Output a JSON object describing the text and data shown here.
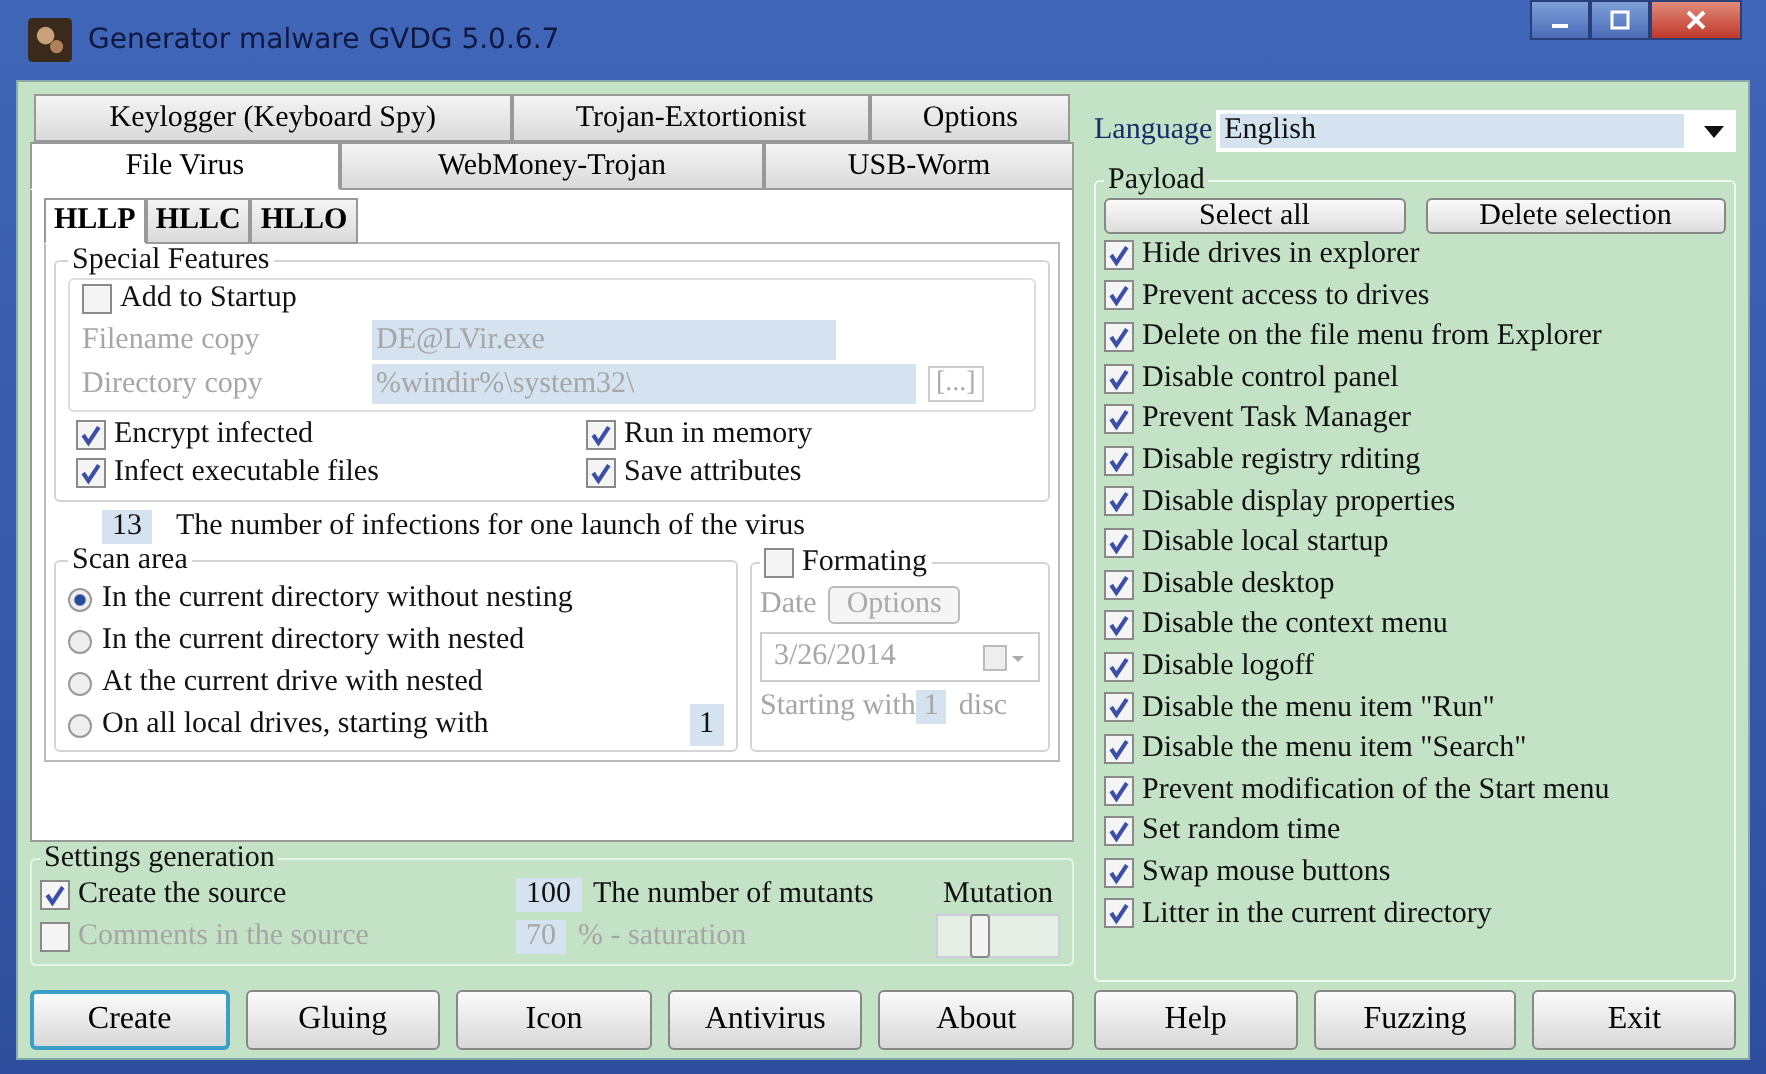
{
  "window": {
    "title": "Generator malware GVDG 5.0.6.7"
  },
  "main_tab_rows": [
    [
      {
        "label": "Keylogger (Keyboard Spy)",
        "selected": false
      },
      {
        "label": "Trojan-Extortionist",
        "selected": false
      },
      {
        "label": "Options",
        "selected": false
      }
    ],
    [
      {
        "label": "File Virus",
        "selected": true
      },
      {
        "label": "WebMoney-Trojan",
        "selected": false
      },
      {
        "label": "USB-Worm",
        "selected": false
      }
    ]
  ],
  "sub_tabs": [
    {
      "label": "HLLP",
      "selected": true
    },
    {
      "label": "HLLC",
      "selected": false
    },
    {
      "label": "HLLO",
      "selected": false
    }
  ],
  "special_features": {
    "title": "Special Features",
    "add_to_startup": {
      "label": "Add to Startup",
      "checked": false
    },
    "fields": [
      {
        "label": "Filename copy",
        "value": "DE@LVir.exe",
        "disabled": true
      },
      {
        "label": "Directory copy",
        "value": "%windir%\\system32\\",
        "disabled": true,
        "browse": "[...]"
      }
    ],
    "options": [
      {
        "label": "Encrypt infected",
        "checked": true
      },
      {
        "label": "Run in memory",
        "checked": true
      },
      {
        "label": "Infect executable files",
        "checked": true
      },
      {
        "label": "Save attributes",
        "checked": true
      }
    ]
  },
  "infections": {
    "value": "13",
    "label": "The number of infections for one launch of the virus"
  },
  "scan_area": {
    "title": "Scan area",
    "options": [
      {
        "label": "In the current directory without nesting",
        "selected": true
      },
      {
        "label": "In the current directory with nested",
        "selected": false
      },
      {
        "label": "At the current drive with nested",
        "selected": false
      },
      {
        "label": "On all local drives, starting with",
        "selected": false
      }
    ],
    "drive_value": "1"
  },
  "formatting": {
    "label": "Formating",
    "checked": false,
    "date_label": "Date",
    "options_button": "Options",
    "date": "3/26/2014",
    "starting_label": "Starting with",
    "disc_value": "1",
    "disc_label": "disc"
  },
  "settings_generation": {
    "title": "Settings generation",
    "create_source": {
      "label": "Create the source",
      "checked": true
    },
    "comments": {
      "label": "Comments in the source",
      "checked": false,
      "disabled": true
    },
    "mutants": {
      "value": "100",
      "label": "The number of mutants"
    },
    "saturation": {
      "value": "70",
      "label": "% - saturation",
      "disabled": true
    },
    "mutation": {
      "label": "Mutation",
      "level": 0.35
    }
  },
  "language": {
    "label": "Language",
    "value": "English"
  },
  "payload": {
    "title": "Payload",
    "buttons": [
      "Select all",
      "Delete selection"
    ],
    "items": [
      {
        "label": "Hide drives in explorer",
        "checked": true
      },
      {
        "label": "Prevent access to drives",
        "checked": true
      },
      {
        "label": "Delete on the file menu from Explorer",
        "checked": true
      },
      {
        "label": "Disable control panel",
        "checked": true
      },
      {
        "label": "Prevent Task Manager",
        "checked": true
      },
      {
        "label": "Disable registry rditing",
        "checked": true
      },
      {
        "label": "Disable display properties",
        "checked": true
      },
      {
        "label": "Disable local startup",
        "checked": true
      },
      {
        "label": "Disable desktop",
        "checked": true
      },
      {
        "label": "Disable the context menu",
        "checked": true
      },
      {
        "label": "Disable logoff",
        "checked": true
      },
      {
        "label": "Disable the menu item \"Run\"",
        "checked": true
      },
      {
        "label": "Disable the menu item \"Search\"",
        "checked": true
      },
      {
        "label": "Prevent modification of the Start menu",
        "checked": true
      },
      {
        "label": "Set random time",
        "checked": true
      },
      {
        "label": "Swap mouse buttons",
        "checked": true
      },
      {
        "label": "Litter in the current directory",
        "checked": true
      }
    ]
  },
  "left_buttons": [
    {
      "label": "Create",
      "selected": true
    },
    {
      "label": "Gluing",
      "selected": false
    },
    {
      "label": "Icon",
      "selected": false
    },
    {
      "label": "Antivirus",
      "selected": false
    },
    {
      "label": "About",
      "selected": false
    }
  ],
  "right_buttons": [
    {
      "label": "Help",
      "selected": false
    },
    {
      "label": "Fuzzing",
      "selected": false
    },
    {
      "label": "Exit",
      "selected": false
    }
  ]
}
